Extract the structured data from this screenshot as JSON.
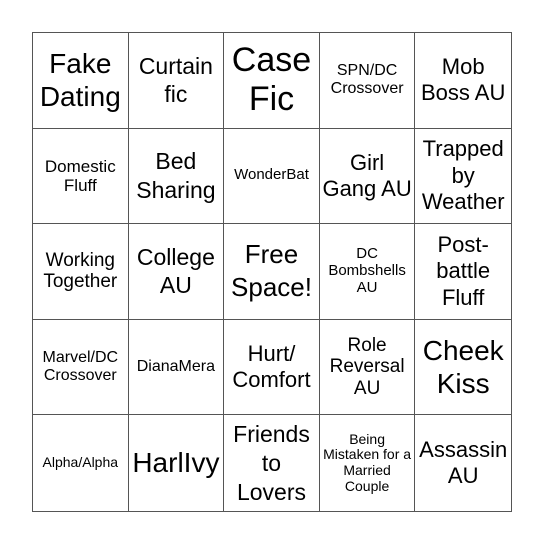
{
  "bingo": {
    "cells": [
      "Fake Dating",
      "Curtain fic",
      "Case Fic",
      "SPN/DC Crossover",
      "Mob Boss AU",
      "Domestic Fluff",
      "Bed Sharing",
      "WonderBat",
      "Girl Gang AU",
      "Trapped by Weather",
      "Working Together",
      "College AU",
      "Free Space!",
      "DC Bombshells AU",
      "Post-battle Fluff",
      "Marvel/DC Crossover",
      "DianaMera",
      "Hurt/ Comfort",
      "Role Reversal AU",
      "Cheek Kiss",
      "Alpha/Alpha",
      "HarlIvy",
      "Friends to Lovers",
      "Being Mistaken for a Married Couple",
      "Assassin AU"
    ]
  }
}
